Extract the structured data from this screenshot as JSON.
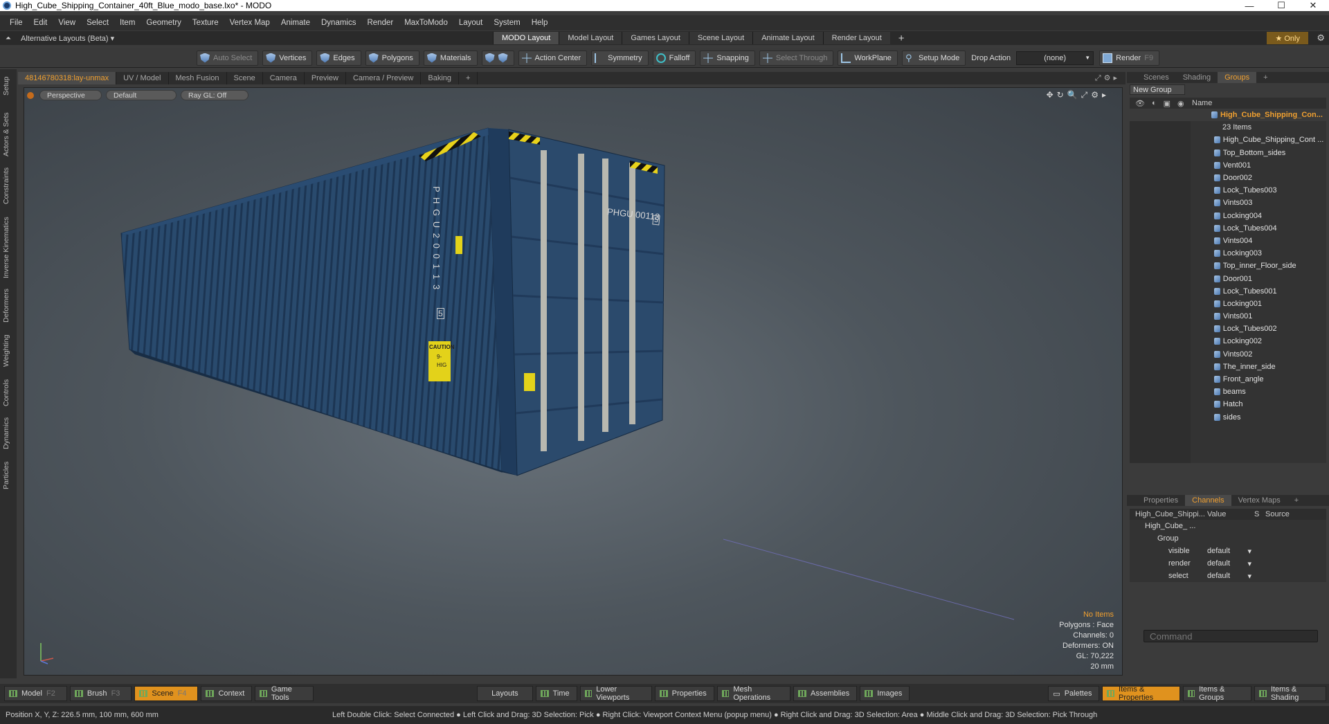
{
  "window": {
    "title": "High_Cube_Shipping_Container_40ft_Blue_modo_base.lxo* - MODO",
    "controls": [
      "—",
      "☐",
      "✕"
    ]
  },
  "menu": [
    "File",
    "Edit",
    "View",
    "Select",
    "Item",
    "Geometry",
    "Texture",
    "Vertex Map",
    "Animate",
    "Dynamics",
    "Render",
    "MaxToModo",
    "Layout",
    "System",
    "Help"
  ],
  "layoutbar": {
    "alt_layout": "Alternative Layouts (Beta) ▾",
    "tabs": [
      "MODO Layout",
      "Model Layout",
      "Games Layout",
      "Scene Layout",
      "Animate Layout",
      "Render Layout"
    ],
    "active_tab": "MODO Layout",
    "only_label": "★  Only"
  },
  "toolbar": {
    "auto_select": "Auto Select",
    "vertices": "Vertices",
    "edges": "Edges",
    "polygons": "Polygons",
    "materials": "Materials",
    "action_center": "Action Center",
    "symmetry": "Symmetry",
    "falloff": "Falloff",
    "snapping": "Snapping",
    "select_through": "Select Through",
    "workplane": "WorkPlane",
    "setup_mode": "Setup Mode",
    "drop_action_label": "Drop Action",
    "drop_action_value": "(none)",
    "render": "Render",
    "render_key": "F9"
  },
  "left_tabs": [
    "Setup",
    "Actors & Sets",
    "Constraints",
    "Inverse Kinematics",
    "Deformers",
    "Weighting",
    "Controls",
    "Dynamics",
    "Particles"
  ],
  "viewport_tabs": [
    "48146780318:lay-unmax",
    "UV / Model",
    "Mesh Fusion",
    "Scene",
    "Camera",
    "Preview",
    "Camera / Preview",
    "Baking",
    "+"
  ],
  "viewport": {
    "view": "Perspective",
    "shading": "Default",
    "raygl": "Ray GL: Off",
    "stats": {
      "no_items": "No Items",
      "polygons": "Polygons : Face",
      "channels": "Channels: 0",
      "deformers": "Deformers: ON",
      "gl": "GL: 70,222",
      "scale": "20 mm"
    },
    "container_text": {
      "side_id": "P H G U  2 0 0 1 1 3",
      "side_check": "5",
      "door_id": "PHGU  00113",
      "door_check": "5",
      "caution": "CAUTION",
      "caution_sub": "9-",
      "caution_sub2": "HIG"
    }
  },
  "right_panel": {
    "top_tabs": [
      "Scenes",
      "Shading",
      "Groups",
      "+"
    ],
    "active_top_tab": "Groups",
    "new_group": "New Group",
    "name_header": "Name",
    "root": {
      "label": "High_Cube_Shipping_Con...",
      "count": "23 Items"
    },
    "items": [
      "High_Cube_Shipping_Cont ...",
      "Top_Bottom_sides",
      "Vent001",
      "Door002",
      "Lock_Tubes003",
      "Vints003",
      "Locking004",
      "Lock_Tubes004",
      "Vints004",
      "Locking003",
      "Top_inner_Floor_side",
      "Door001",
      "Lock_Tubes001",
      "Locking001",
      "Vints001",
      "Lock_Tubes002",
      "Locking002",
      "Vints002",
      "The_inner_side",
      "Front_angle",
      "beams",
      "Hatch",
      "sides"
    ],
    "props_tabs": [
      "Properties",
      "Channels",
      "Vertex Maps",
      "+"
    ],
    "active_props_tab": "Channels",
    "channel_headers": {
      "name": "High_Cube_Shippi...",
      "value": "Value",
      "s": "S",
      "source": "Source"
    },
    "channel_rows": [
      {
        "name": "High_Cube_ ...",
        "value": ""
      },
      {
        "name": "Group",
        "value": ""
      },
      {
        "name": "visible",
        "value": "default"
      },
      {
        "name": "render",
        "value": "default"
      },
      {
        "name": "select",
        "value": "default"
      }
    ],
    "command_placeholder": "Command"
  },
  "bottom_bar": {
    "left": [
      {
        "label": "Model",
        "key": "F2"
      },
      {
        "label": "Brush",
        "key": "F3"
      },
      {
        "label": "Scene",
        "key": "F4"
      },
      {
        "label": "Context",
        "key": ""
      },
      {
        "label": "Game Tools",
        "key": ""
      }
    ],
    "active": "Scene",
    "middle": [
      "Layouts",
      "Time",
      "Lower Viewports",
      "Properties",
      "Mesh Operations",
      "Assemblies",
      "Images"
    ],
    "right": [
      "Palettes",
      "Items & Properties",
      "Items & Groups",
      "Items & Shading"
    ],
    "right_active": "Items & Properties"
  },
  "status": {
    "position": "Position X, Y, Z:   226.5 mm, 100 mm, 600 mm",
    "hint": "Left Double Click: Select Connected ● Left Click and Drag: 3D Selection: Pick ● Right Click: Viewport Context Menu (popup menu) ● Right Click and Drag: 3D Selection: Area ● Middle Click and Drag: 3D Selection: Pick Through"
  }
}
